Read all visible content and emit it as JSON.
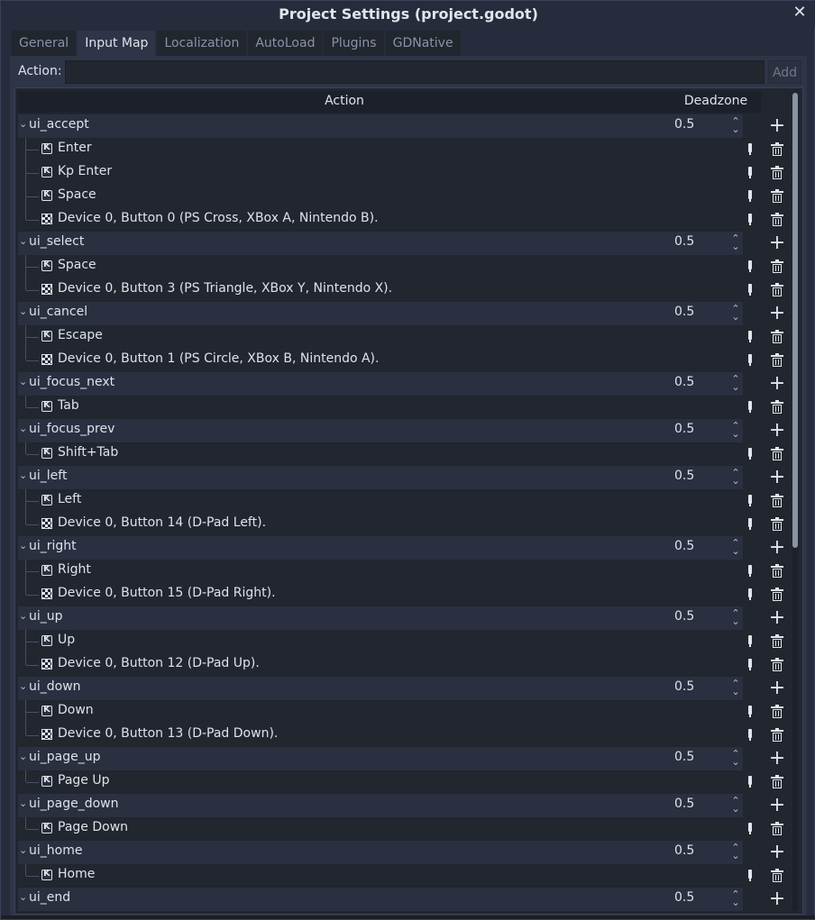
{
  "window": {
    "title": "Project Settings (project.godot)"
  },
  "tabs": [
    {
      "label": "General",
      "active": false
    },
    {
      "label": "Input Map",
      "active": true
    },
    {
      "label": "Localization",
      "active": false
    },
    {
      "label": "AutoLoad",
      "active": false
    },
    {
      "label": "Plugins",
      "active": false
    },
    {
      "label": "GDNative",
      "active": false
    }
  ],
  "action_bar": {
    "label": "Action:",
    "input_value": "",
    "add_label": "Add"
  },
  "tree": {
    "headers": {
      "action": "Action",
      "deadzone": "Deadzone"
    },
    "actions": [
      {
        "name": "ui_accept",
        "deadzone": "0.5",
        "events": [
          {
            "type": "key",
            "label": "Enter"
          },
          {
            "type": "key",
            "label": "Kp Enter"
          },
          {
            "type": "key",
            "label": "Space"
          },
          {
            "type": "joy",
            "label": "Device 0, Button 0 (PS Cross, XBox A, Nintendo B)."
          }
        ]
      },
      {
        "name": "ui_select",
        "deadzone": "0.5",
        "events": [
          {
            "type": "key",
            "label": "Space"
          },
          {
            "type": "joy",
            "label": "Device 0, Button 3 (PS Triangle, XBox Y, Nintendo X)."
          }
        ]
      },
      {
        "name": "ui_cancel",
        "deadzone": "0.5",
        "events": [
          {
            "type": "key",
            "label": "Escape"
          },
          {
            "type": "joy",
            "label": "Device 0, Button 1 (PS Circle, XBox B, Nintendo A)."
          }
        ]
      },
      {
        "name": "ui_focus_next",
        "deadzone": "0.5",
        "events": [
          {
            "type": "key",
            "label": "Tab"
          }
        ]
      },
      {
        "name": "ui_focus_prev",
        "deadzone": "0.5",
        "events": [
          {
            "type": "key",
            "label": "Shift+Tab"
          }
        ]
      },
      {
        "name": "ui_left",
        "deadzone": "0.5",
        "events": [
          {
            "type": "key",
            "label": "Left"
          },
          {
            "type": "joy",
            "label": "Device 0, Button 14 (D-Pad Left)."
          }
        ]
      },
      {
        "name": "ui_right",
        "deadzone": "0.5",
        "events": [
          {
            "type": "key",
            "label": "Right"
          },
          {
            "type": "joy",
            "label": "Device 0, Button 15 (D-Pad Right)."
          }
        ]
      },
      {
        "name": "ui_up",
        "deadzone": "0.5",
        "events": [
          {
            "type": "key",
            "label": "Up"
          },
          {
            "type": "joy",
            "label": "Device 0, Button 12 (D-Pad Up)."
          }
        ]
      },
      {
        "name": "ui_down",
        "deadzone": "0.5",
        "events": [
          {
            "type": "key",
            "label": "Down"
          },
          {
            "type": "joy",
            "label": "Device 0, Button 13 (D-Pad Down)."
          }
        ]
      },
      {
        "name": "ui_page_up",
        "deadzone": "0.5",
        "events": [
          {
            "type": "key",
            "label": "Page Up"
          }
        ]
      },
      {
        "name": "ui_page_down",
        "deadzone": "0.5",
        "events": [
          {
            "type": "key",
            "label": "Page Down"
          }
        ]
      },
      {
        "name": "ui_home",
        "deadzone": "0.5",
        "events": [
          {
            "type": "key",
            "label": "Home"
          }
        ]
      },
      {
        "name": "ui_end",
        "deadzone": "0.5",
        "events": []
      }
    ]
  },
  "icons": {
    "close": "close-icon",
    "add": "plus-icon",
    "edit": "edit-icon",
    "delete": "trash-icon",
    "key_event": "keyboard-icon",
    "joy_event": "joypad-icon",
    "collapse": "chevron-down-icon",
    "spin": "spinbox-arrows-icon"
  },
  "colors": {
    "window_bg": "#262c3b",
    "panel_bg": "#2e3546",
    "tree_bg": "#21262f",
    "action_row_bg": "#2a3040",
    "text": "#dde3ec",
    "muted_text": "#8a93a5"
  }
}
